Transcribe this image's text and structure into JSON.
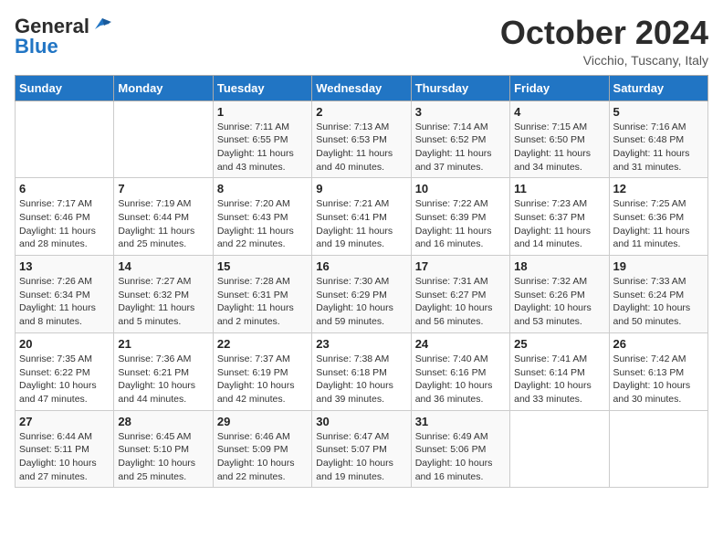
{
  "logo": {
    "line1": "General",
    "line2": "Blue",
    "icon": "▶"
  },
  "header": {
    "month_title": "October 2024",
    "location": "Vicchio, Tuscany, Italy"
  },
  "weekdays": [
    "Sunday",
    "Monday",
    "Tuesday",
    "Wednesday",
    "Thursday",
    "Friday",
    "Saturday"
  ],
  "weeks": [
    [
      {
        "day": "",
        "detail": ""
      },
      {
        "day": "",
        "detail": ""
      },
      {
        "day": "1",
        "detail": "Sunrise: 7:11 AM\nSunset: 6:55 PM\nDaylight: 11 hours and 43 minutes."
      },
      {
        "day": "2",
        "detail": "Sunrise: 7:13 AM\nSunset: 6:53 PM\nDaylight: 11 hours and 40 minutes."
      },
      {
        "day": "3",
        "detail": "Sunrise: 7:14 AM\nSunset: 6:52 PM\nDaylight: 11 hours and 37 minutes."
      },
      {
        "day": "4",
        "detail": "Sunrise: 7:15 AM\nSunset: 6:50 PM\nDaylight: 11 hours and 34 minutes."
      },
      {
        "day": "5",
        "detail": "Sunrise: 7:16 AM\nSunset: 6:48 PM\nDaylight: 11 hours and 31 minutes."
      }
    ],
    [
      {
        "day": "6",
        "detail": "Sunrise: 7:17 AM\nSunset: 6:46 PM\nDaylight: 11 hours and 28 minutes."
      },
      {
        "day": "7",
        "detail": "Sunrise: 7:19 AM\nSunset: 6:44 PM\nDaylight: 11 hours and 25 minutes."
      },
      {
        "day": "8",
        "detail": "Sunrise: 7:20 AM\nSunset: 6:43 PM\nDaylight: 11 hours and 22 minutes."
      },
      {
        "day": "9",
        "detail": "Sunrise: 7:21 AM\nSunset: 6:41 PM\nDaylight: 11 hours and 19 minutes."
      },
      {
        "day": "10",
        "detail": "Sunrise: 7:22 AM\nSunset: 6:39 PM\nDaylight: 11 hours and 16 minutes."
      },
      {
        "day": "11",
        "detail": "Sunrise: 7:23 AM\nSunset: 6:37 PM\nDaylight: 11 hours and 14 minutes."
      },
      {
        "day": "12",
        "detail": "Sunrise: 7:25 AM\nSunset: 6:36 PM\nDaylight: 11 hours and 11 minutes."
      }
    ],
    [
      {
        "day": "13",
        "detail": "Sunrise: 7:26 AM\nSunset: 6:34 PM\nDaylight: 11 hours and 8 minutes."
      },
      {
        "day": "14",
        "detail": "Sunrise: 7:27 AM\nSunset: 6:32 PM\nDaylight: 11 hours and 5 minutes."
      },
      {
        "day": "15",
        "detail": "Sunrise: 7:28 AM\nSunset: 6:31 PM\nDaylight: 11 hours and 2 minutes."
      },
      {
        "day": "16",
        "detail": "Sunrise: 7:30 AM\nSunset: 6:29 PM\nDaylight: 10 hours and 59 minutes."
      },
      {
        "day": "17",
        "detail": "Sunrise: 7:31 AM\nSunset: 6:27 PM\nDaylight: 10 hours and 56 minutes."
      },
      {
        "day": "18",
        "detail": "Sunrise: 7:32 AM\nSunset: 6:26 PM\nDaylight: 10 hours and 53 minutes."
      },
      {
        "day": "19",
        "detail": "Sunrise: 7:33 AM\nSunset: 6:24 PM\nDaylight: 10 hours and 50 minutes."
      }
    ],
    [
      {
        "day": "20",
        "detail": "Sunrise: 7:35 AM\nSunset: 6:22 PM\nDaylight: 10 hours and 47 minutes."
      },
      {
        "day": "21",
        "detail": "Sunrise: 7:36 AM\nSunset: 6:21 PM\nDaylight: 10 hours and 44 minutes."
      },
      {
        "day": "22",
        "detail": "Sunrise: 7:37 AM\nSunset: 6:19 PM\nDaylight: 10 hours and 42 minutes."
      },
      {
        "day": "23",
        "detail": "Sunrise: 7:38 AM\nSunset: 6:18 PM\nDaylight: 10 hours and 39 minutes."
      },
      {
        "day": "24",
        "detail": "Sunrise: 7:40 AM\nSunset: 6:16 PM\nDaylight: 10 hours and 36 minutes."
      },
      {
        "day": "25",
        "detail": "Sunrise: 7:41 AM\nSunset: 6:14 PM\nDaylight: 10 hours and 33 minutes."
      },
      {
        "day": "26",
        "detail": "Sunrise: 7:42 AM\nSunset: 6:13 PM\nDaylight: 10 hours and 30 minutes."
      }
    ],
    [
      {
        "day": "27",
        "detail": "Sunrise: 6:44 AM\nSunset: 5:11 PM\nDaylight: 10 hours and 27 minutes."
      },
      {
        "day": "28",
        "detail": "Sunrise: 6:45 AM\nSunset: 5:10 PM\nDaylight: 10 hours and 25 minutes."
      },
      {
        "day": "29",
        "detail": "Sunrise: 6:46 AM\nSunset: 5:09 PM\nDaylight: 10 hours and 22 minutes."
      },
      {
        "day": "30",
        "detail": "Sunrise: 6:47 AM\nSunset: 5:07 PM\nDaylight: 10 hours and 19 minutes."
      },
      {
        "day": "31",
        "detail": "Sunrise: 6:49 AM\nSunset: 5:06 PM\nDaylight: 10 hours and 16 minutes."
      },
      {
        "day": "",
        "detail": ""
      },
      {
        "day": "",
        "detail": ""
      }
    ]
  ]
}
